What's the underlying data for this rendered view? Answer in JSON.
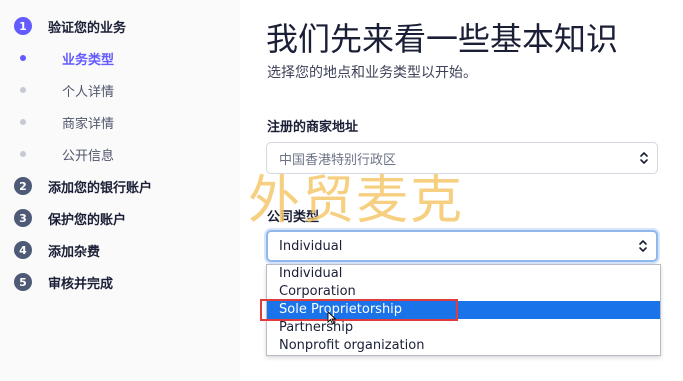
{
  "sidebar": {
    "steps": [
      {
        "num": "1",
        "label": "验证您的业务"
      },
      {
        "num": "2",
        "label": "添加您的银行账户"
      },
      {
        "num": "3",
        "label": "保护您的账户"
      },
      {
        "num": "4",
        "label": "添加杂费"
      },
      {
        "num": "5",
        "label": "审核并完成"
      }
    ],
    "substeps": [
      {
        "label": "业务类型"
      },
      {
        "label": "个人详情"
      },
      {
        "label": "商家详情"
      },
      {
        "label": "公开信息"
      }
    ]
  },
  "main": {
    "title": "我们先来看一些基本知识",
    "subtitle": "选择您的地点和业务类型以开始。",
    "address": {
      "label": "注册的商家地址",
      "value": "中国香港特别行政区"
    },
    "company_type": {
      "label": "公司类型",
      "value": "Individual",
      "options": [
        "Individual",
        "Corporation",
        "Sole Proprietorship",
        "Partnership",
        "Nonprofit organization"
      ],
      "highlighted_index": 2
    }
  },
  "watermark": {
    "text": "外贸麦克"
  },
  "colors": {
    "accent": "#635bff",
    "highlight": "#1a73e8",
    "annotation_box": "#e23b3b",
    "watermark": "#f5c86b"
  }
}
